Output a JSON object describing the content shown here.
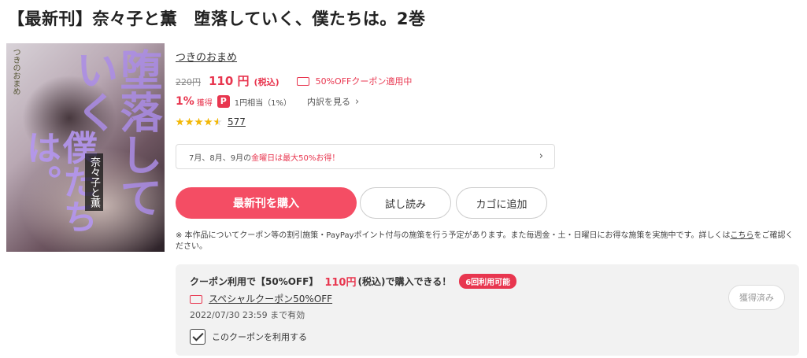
{
  "title": "【最新刊】奈々子と薫　堕落していく、僕たちは。2巻",
  "cover": {
    "big_text": "堕落していく",
    "big_text2": "僕たちは。",
    "subtitle": "奈々子と薫",
    "author_text": "つきのおまめ",
    "volume": "2"
  },
  "author": "つきのおまめ",
  "price": {
    "original": "220円",
    "current": "110 円",
    "tax": "(税込)",
    "coupon_note": "50%OFFクーポン適用中"
  },
  "points": {
    "percent": "1%",
    "get_label": "獲得",
    "icon": "P",
    "equivalent": "1円相当（1%）",
    "detail_link": "内訳を見る"
  },
  "rating": {
    "stars": 4.5,
    "review_count": "577",
    "star_color": "#f2b705"
  },
  "campaign": {
    "prefix": "7月、8月、9月の",
    "highlight": "金曜日は最大50%お得！"
  },
  "buttons": {
    "buy": "最新刊を購入",
    "trial": "試し読み",
    "cart": "カゴに追加"
  },
  "notice": {
    "text": "※ 本作品についてクーポン等の割引施策・PayPayポイント付与の施策を行う予定があります。また毎週金・土・日曜日にお得な施策を実施中です。詳しくは",
    "link": "こちら",
    "suffix": "をご確認ください。"
  },
  "coupon": {
    "head_prefix": "クーポン利用で【50%OFF】",
    "head_price": "110円",
    "head_suffix": "(税込)で購入できる！",
    "badge": "6回利用可能",
    "name": "スペシャルクーポン50%OFF",
    "expiry": "2022/07/30 23:59 まで有効",
    "use_label": "このクーポンを利用する",
    "use_checked": true,
    "acquired_button": "獲得済み"
  },
  "colors": {
    "accent": "#e8364f",
    "buy_button": "#f44d64"
  }
}
